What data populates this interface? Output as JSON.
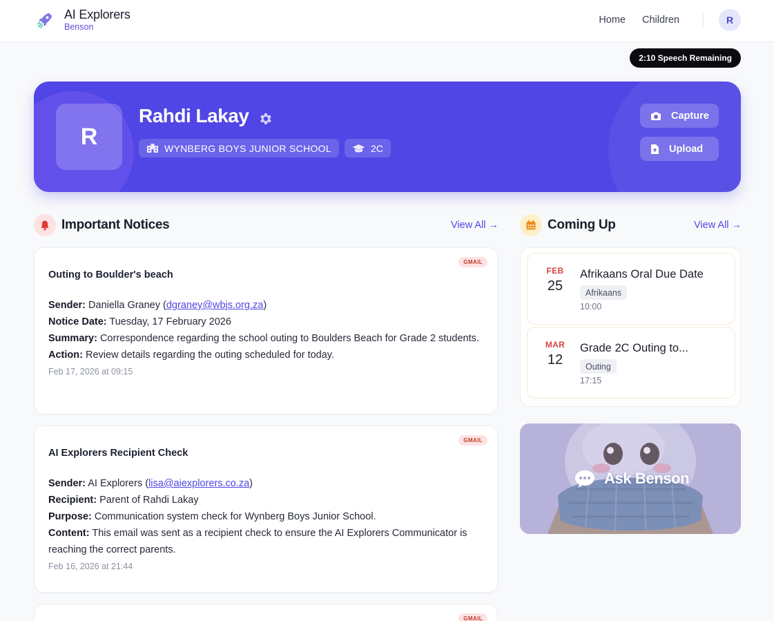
{
  "header": {
    "brand_title": "AI Explorers",
    "brand_subtitle": "Benson",
    "nav": [
      "Home",
      "Children"
    ],
    "avatar_initial": "R"
  },
  "speech_remaining": "2:10 Speech Remaining",
  "profile": {
    "initial": "R",
    "name": "Rahdi Lakay",
    "school": "WYNBERG BOYS JUNIOR SCHOOL",
    "grade": "2C",
    "capture_label": "Capture",
    "upload_label": "Upload"
  },
  "notices_section": {
    "title": "Important Notices",
    "view_all": "View All →",
    "items": [
      {
        "badge": "GMAIL",
        "title": "Outing to Boulder's beach",
        "lines": [
          {
            "label": "Sender:",
            "text": " Daniella Graney (",
            "link": "dgraney@wbjs.org.za",
            "after": ")"
          },
          {
            "label": "Notice Date:",
            "text": " Tuesday, 17 February 2026"
          },
          {
            "label": "Summary:",
            "text": " Correspondence regarding the school outing to Boulders Beach for Grade 2 students."
          },
          {
            "label": "Action:",
            "text": " Review details regarding the outing scheduled for today."
          }
        ],
        "time": "Feb 17, 2026 at 09:15"
      },
      {
        "badge": "GMAIL",
        "title": "AI Explorers Recipient Check",
        "lines": [
          {
            "label": "Sender:",
            "text": " AI Explorers (",
            "link": "lisa@aiexplorers.co.za",
            "after": ")"
          },
          {
            "label": "Recipient:",
            "text": " Parent of Rahdi Lakay"
          },
          {
            "label": "Purpose:",
            "text": " Communication system check for Wynberg Boys Junior School."
          },
          {
            "label": "Content:",
            "text": " This email was sent as a recipient check to ensure the AI Explorers Communicator is reaching the correct parents."
          }
        ],
        "time": "Feb 16, 2026 at 21:44"
      },
      {
        "badge": "GMAIL"
      }
    ]
  },
  "coming_up": {
    "title": "Coming Up",
    "view_all": "View All →",
    "events": [
      {
        "month": "FEB",
        "day": "25",
        "title": "Afrikaans Oral Due Date",
        "tag": "Afrikaans",
        "time": "10:00"
      },
      {
        "month": "MAR",
        "day": "12",
        "title": "Grade 2C Outing to...",
        "tag": "Outing",
        "time": "17:15"
      }
    ]
  },
  "ask": {
    "label": "Ask Benson"
  },
  "colors": {
    "accent": "#4f46e5",
    "notice_icon_bg": "#fde2e2",
    "event_icon_bg": "#fdf0c8",
    "event_month": "#d64545"
  }
}
